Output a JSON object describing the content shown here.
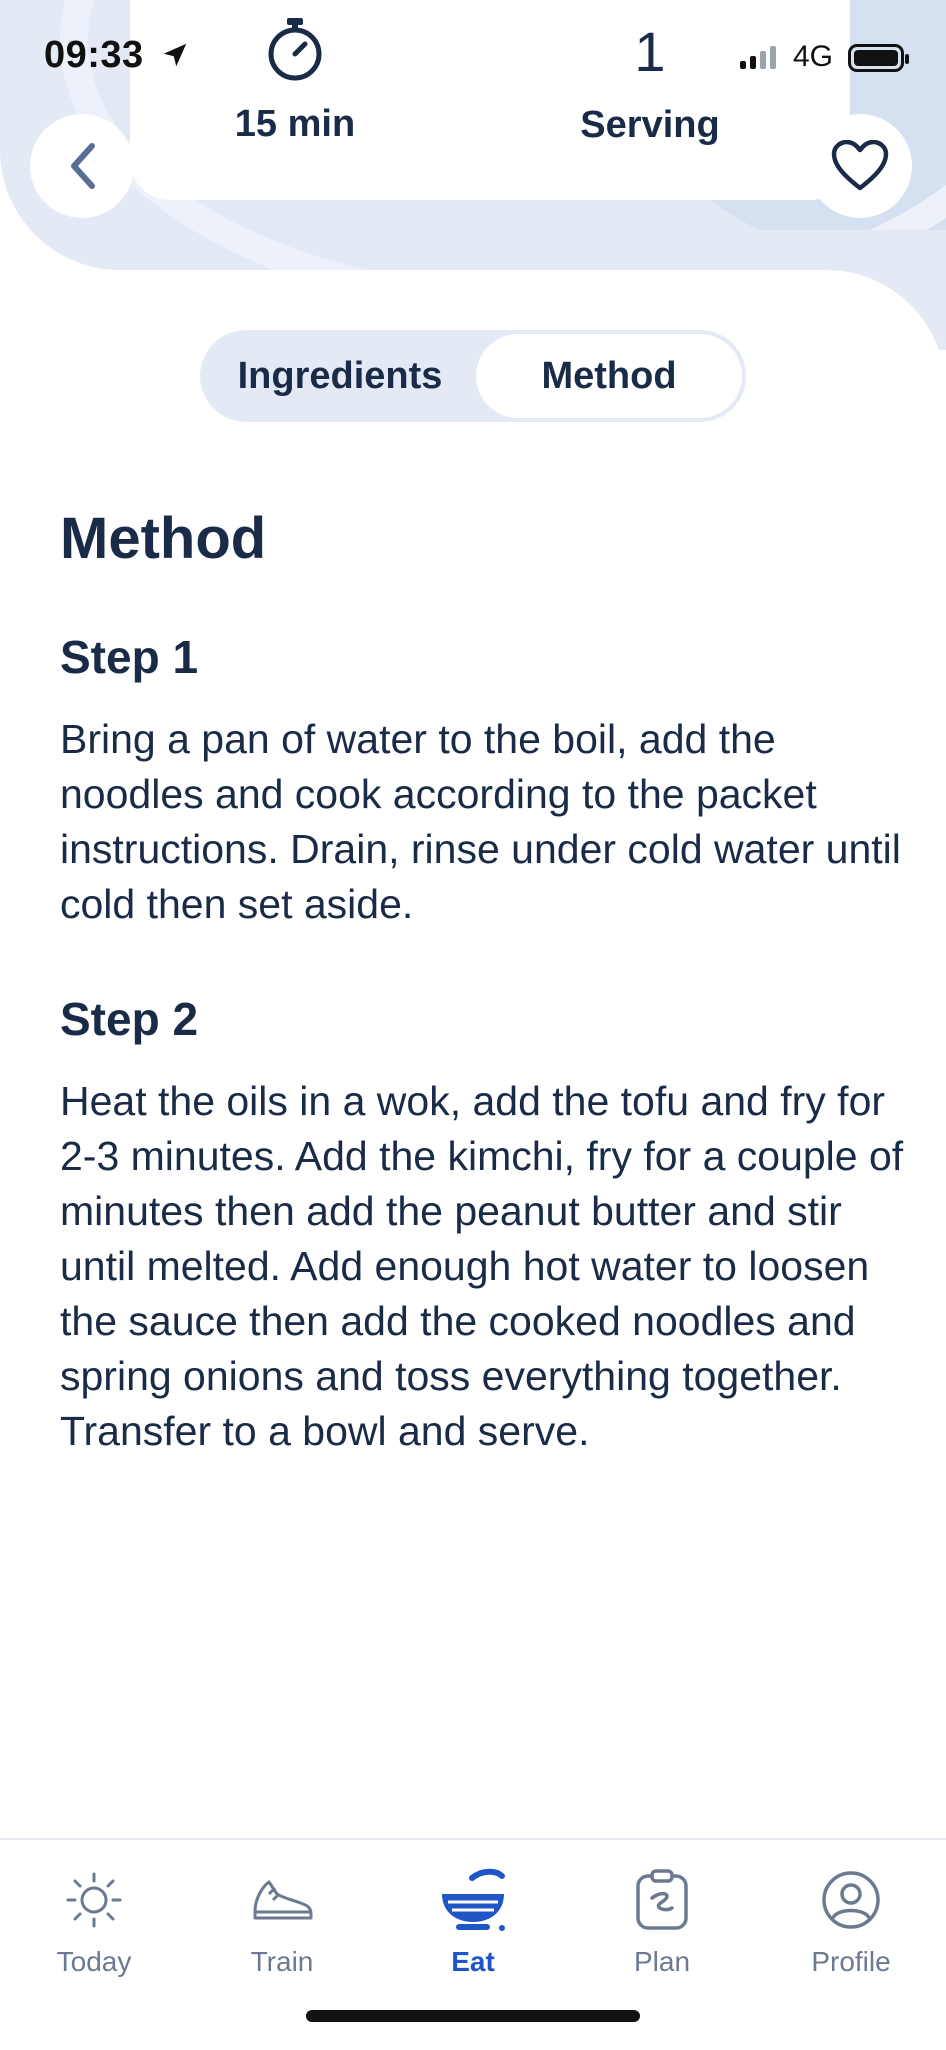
{
  "status_bar": {
    "time": "09:33",
    "network": "4G"
  },
  "header": {
    "duration": "15 min",
    "servings_count": "1",
    "servings_label": "Serving"
  },
  "tabs": {
    "ingredients": "Ingredients",
    "method": "Method",
    "active": "Method"
  },
  "method": {
    "heading": "Method",
    "steps": [
      {
        "title": "Step 1",
        "text": "Bring a pan of water to the boil, add the noodles and cook according to the packet instructions. Drain, rinse under cold water until cold then set aside."
      },
      {
        "title": "Step 2",
        "text": "Heat the oils in a wok, add the tofu and fry for 2-3 minutes. Add the kimchi, fry for a couple of minutes then add the peanut butter and stir until melted. Add enough hot water to loosen the sauce then add the cooked noodles and spring onions and toss everything together. Transfer to a bowl and serve."
      }
    ]
  },
  "tabbar": {
    "items": [
      {
        "label": "Today",
        "icon": "sun-icon"
      },
      {
        "label": "Train",
        "icon": "shoe-icon"
      },
      {
        "label": "Eat",
        "icon": "bowl-icon"
      },
      {
        "label": "Plan",
        "icon": "clipboard-icon"
      },
      {
        "label": "Profile",
        "icon": "user-circle-icon"
      }
    ],
    "active": "Eat"
  },
  "colors": {
    "navy": "#1a2b47",
    "accent": "#1e56c8",
    "header_bg": "#e3eaf6",
    "muted": "#6b7a90"
  }
}
